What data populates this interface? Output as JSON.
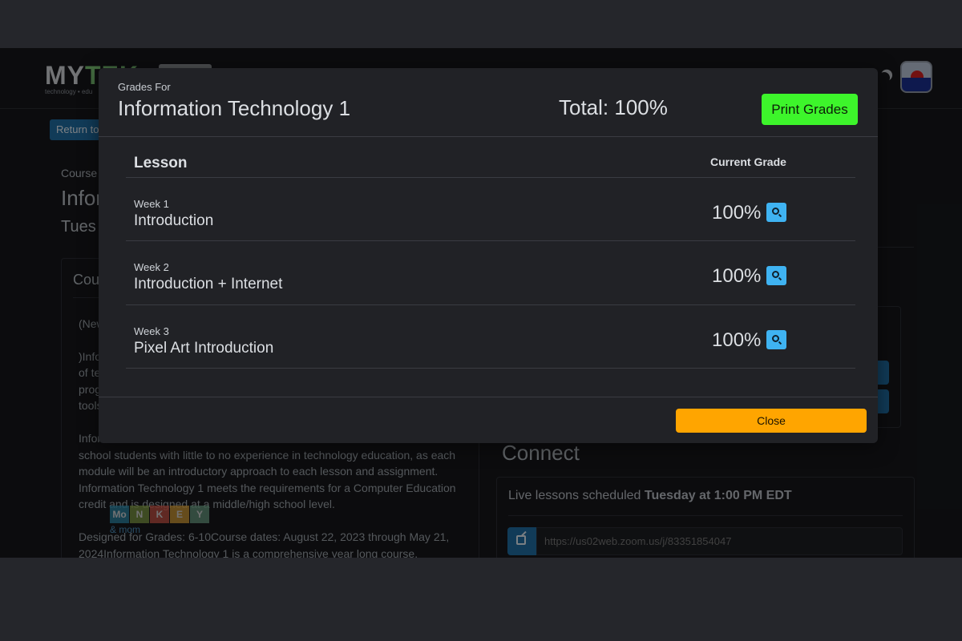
{
  "header": {
    "logo_prefix": "MY",
    "logo_accent": "TEK",
    "logo_tagline": "technology • edu"
  },
  "page": {
    "return_button": "Return to",
    "course_label": "Course",
    "course_title": "Infor",
    "course_day": "Tues",
    "card_title": "Cou",
    "description": [
      "(New",
      ")Info\nof te\nprog\ntools",
      "Infor\nschool students with little to no experience in technology education, as each module will be an introductory approach to each lesson and assignment.\n Information Technology 1 meets the requirements for a Computer Education credit and is designed at a middle/high school level.",
      "Designed for Grades: 6-10Course dates: August 22, 2023 through May 21, 2024Information Technology 1 is a comprehensive year long course."
    ],
    "watermark_letters": [
      "Mo",
      "N",
      "K",
      "E",
      "Y"
    ],
    "watermark_sub": "& mom"
  },
  "connect": {
    "title": "Connect",
    "live_prefix": "Live lessons scheduled ",
    "live_day": "Tuesday",
    "live_mid": " at ",
    "live_time": "1:00 PM EDT",
    "link_url": "https://us02web.zoom.us/j/83351854047"
  },
  "modal": {
    "subtitle": "Grades For",
    "title": "Information Technology 1",
    "total": "Total: 100%",
    "print_label": "Print Grades",
    "col_lesson": "Lesson",
    "col_grade": "Current Grade",
    "rows": [
      {
        "week": "Week 1",
        "lesson": "Introduction",
        "grade": "100%"
      },
      {
        "week": "Week 2",
        "lesson": "Introduction + Internet",
        "grade": "100%"
      },
      {
        "week": "Week 3",
        "lesson": "Pixel Art Introduction",
        "grade": "100%"
      }
    ],
    "close_label": "Close"
  },
  "colors": {
    "print_button": "#3df52b",
    "close_button": "#ffa500",
    "search_button": "#3fb3f2",
    "primary_button": "#1f6ca0"
  },
  "icons": [
    "moon-icon",
    "avatar",
    "search-icon",
    "external-link-icon"
  ]
}
